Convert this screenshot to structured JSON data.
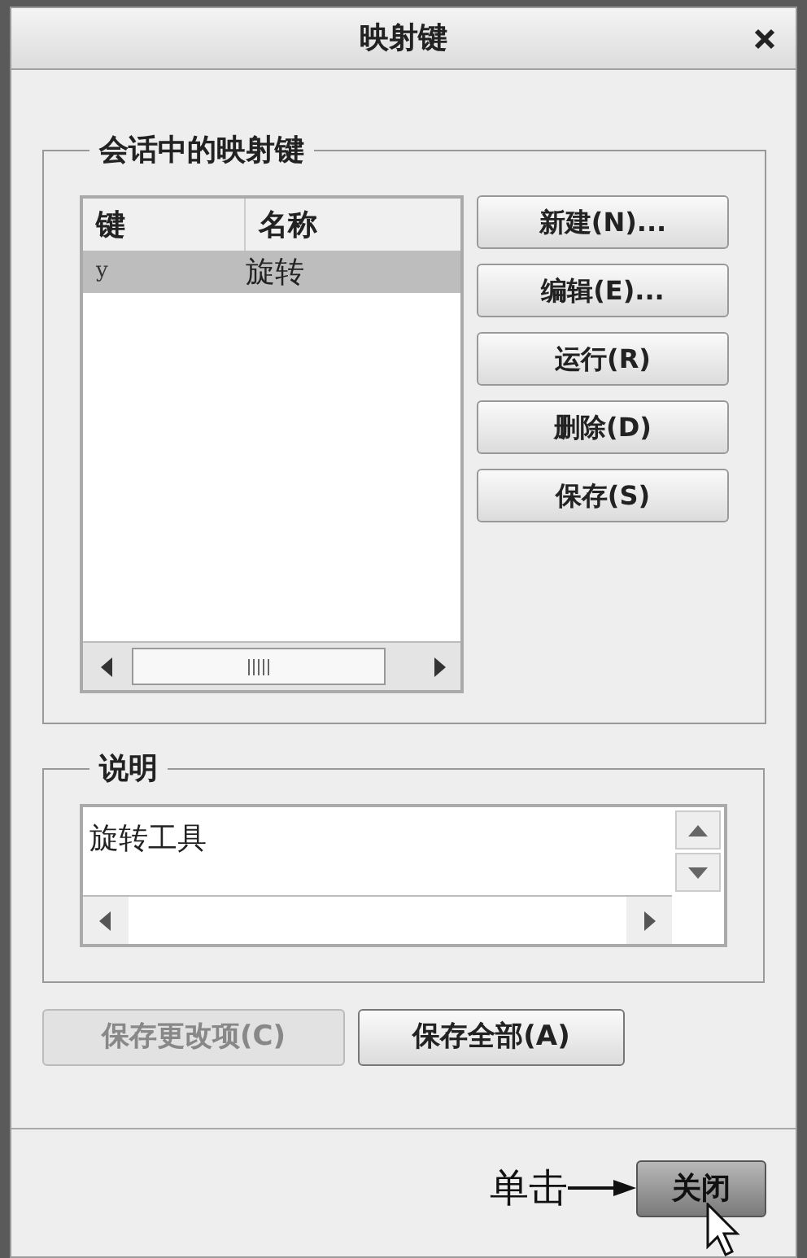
{
  "window": {
    "title": "映射键"
  },
  "session_group": {
    "legend": "会话中的映射键",
    "list": {
      "columns": [
        "键",
        "名称"
      ],
      "rows": [
        {
          "key": "y",
          "name": "旋转",
          "selected": true
        }
      ]
    },
    "buttons": [
      {
        "label": "新建(N)..."
      },
      {
        "label": "编辑(E)..."
      },
      {
        "label": "运行(R)"
      },
      {
        "label": "删除(D)"
      },
      {
        "label": "保存(S)"
      }
    ]
  },
  "description_group": {
    "legend": "说明",
    "text": "旋转工具"
  },
  "actions": [
    {
      "label": "保存更改项(C)",
      "disabled": true
    },
    {
      "label": "保存全部(A)",
      "disabled": false
    }
  ],
  "footer": {
    "annotation": "单击",
    "close_button": "关闭"
  }
}
